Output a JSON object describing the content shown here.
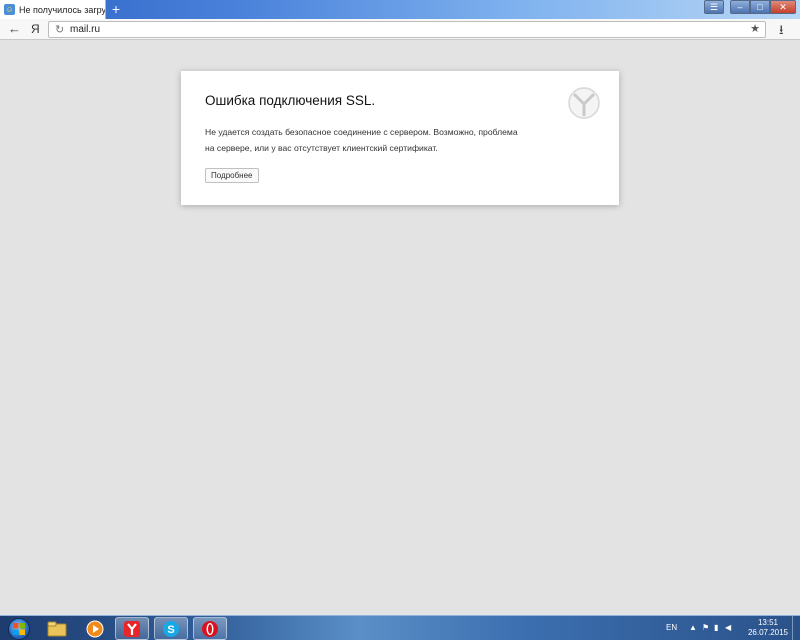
{
  "browser": {
    "tab": {
      "title": "Не получилось загрузить"
    },
    "address": {
      "url": "mail.ru"
    },
    "ya_label": "Я"
  },
  "error": {
    "title": "Ошибка подключения SSL.",
    "line1": "Не удается создать безопасное соединение с сервером. Возможно, проблема",
    "line2": "на сервере, или у вас отсутствует клиентский сертификат.",
    "details_button": "Подробнее"
  },
  "taskbar": {
    "items": [
      "windows-explorer",
      "media-player",
      "yandex-browser",
      "skype",
      "opera"
    ],
    "language": "EN",
    "time": "13:51",
    "date": "26.07.2015"
  },
  "colors": {
    "page_bg": "#e3e3e3",
    "card_bg": "#ffffff",
    "titlebar_accent": "#2d62c4"
  }
}
